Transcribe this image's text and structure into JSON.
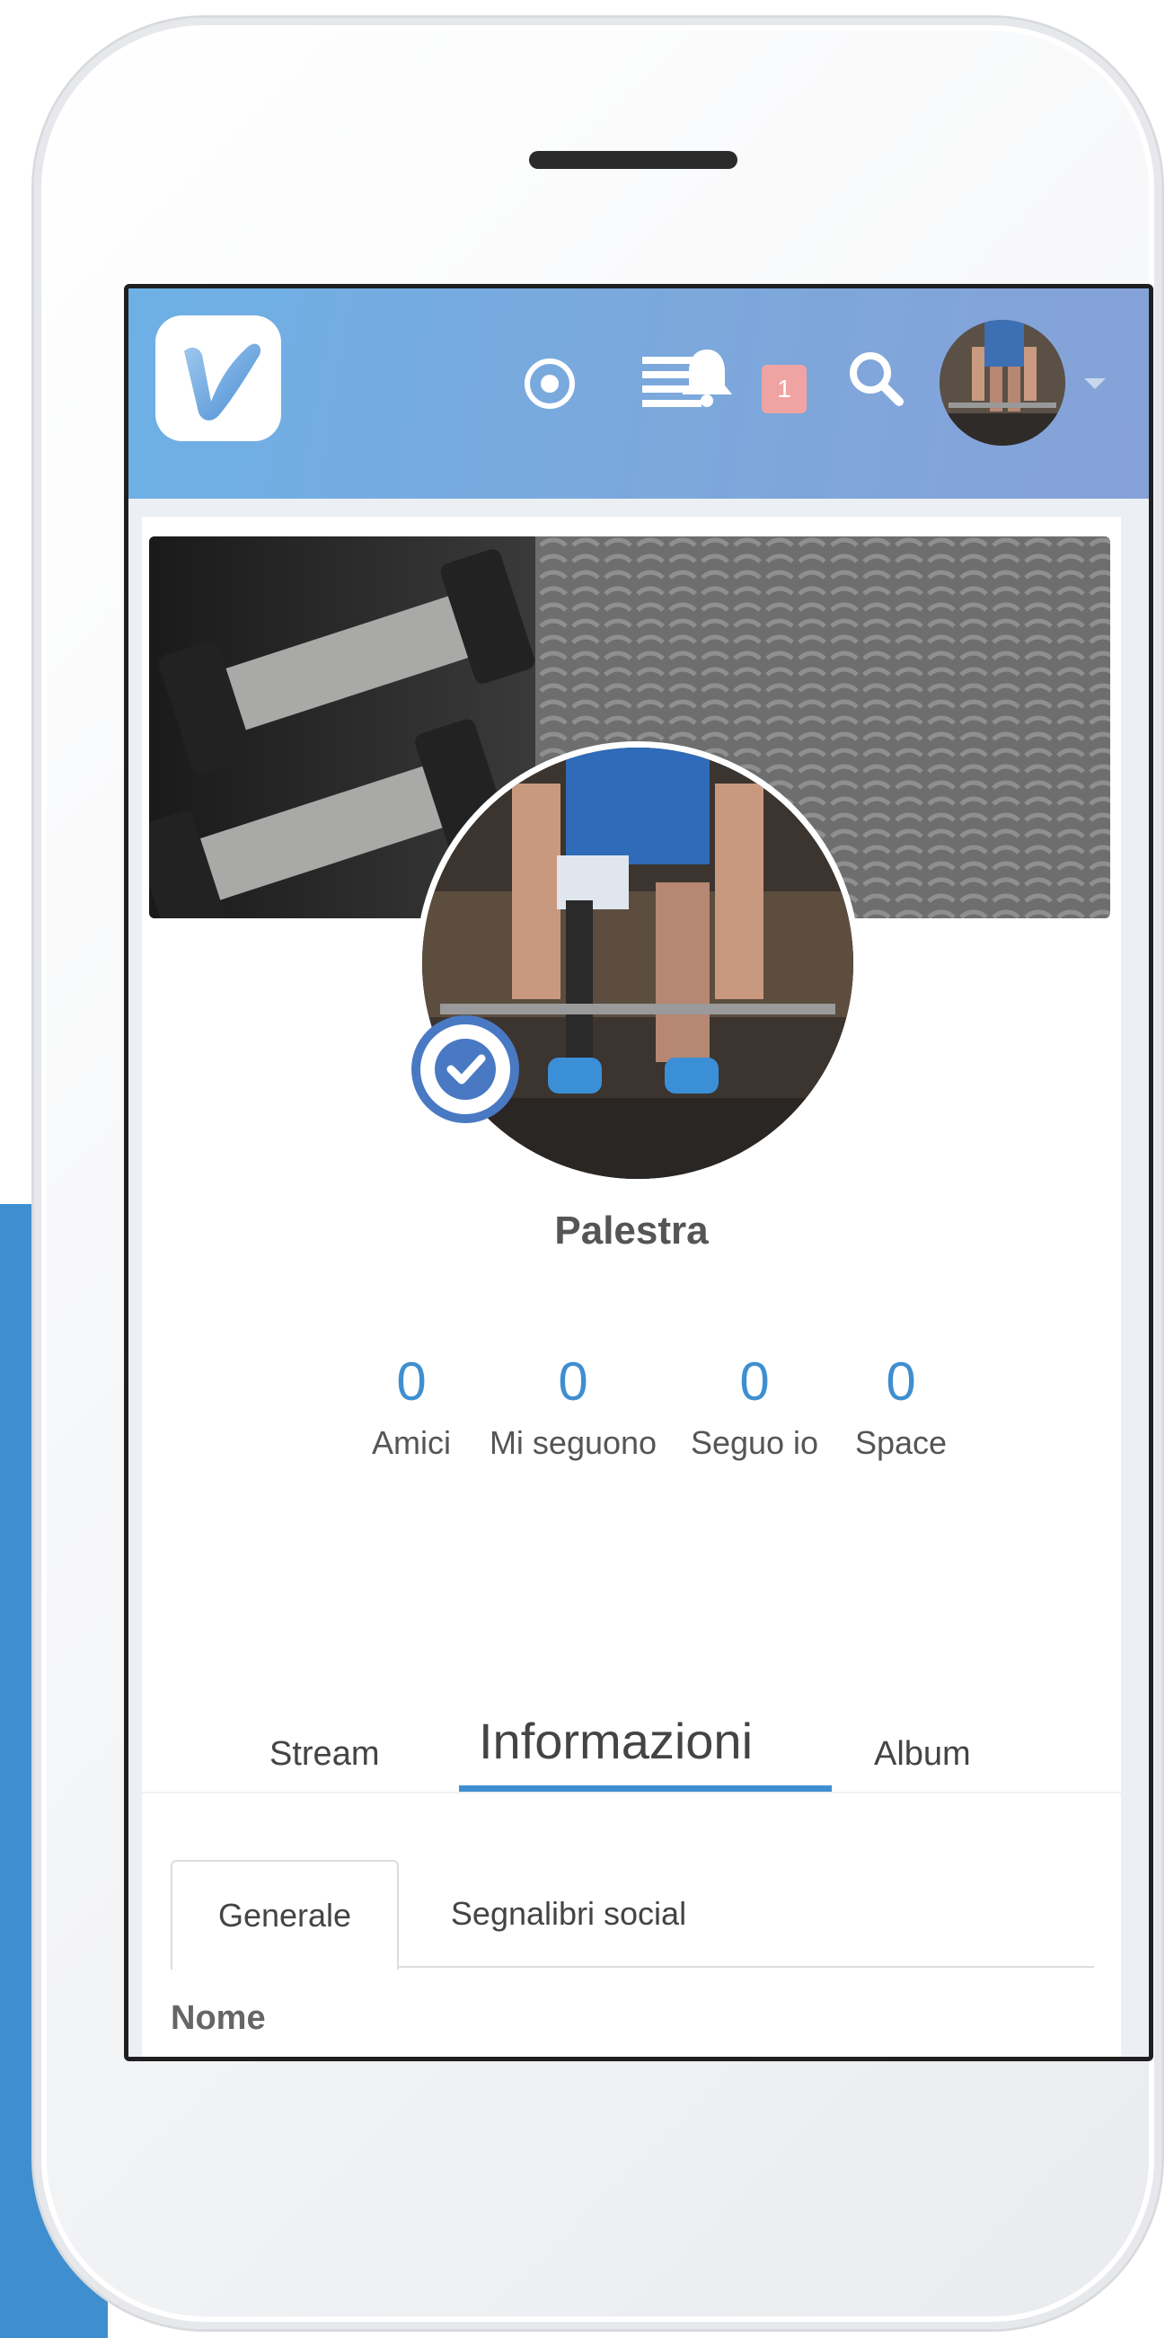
{
  "app": {
    "notifications_count": "1",
    "icons": [
      "logo",
      "target-icon",
      "menu-icon",
      "bell-icon",
      "search-icon",
      "avatar",
      "chevron-down-icon"
    ]
  },
  "profile": {
    "name": "Palestra",
    "stats": [
      {
        "value": "0",
        "label": "Amici"
      },
      {
        "value": "0",
        "label": "Mi seguono"
      },
      {
        "value": "0",
        "label": "Seguo io"
      },
      {
        "value": "0",
        "label": "Space"
      }
    ]
  },
  "tabs": [
    {
      "label": "Stream",
      "active": false
    },
    {
      "label": "Informazioni",
      "active": true
    },
    {
      "label": "Album",
      "active": false
    }
  ],
  "subtabs": [
    {
      "label": "Generale",
      "active": true
    },
    {
      "label": "Segnalibri social",
      "active": false
    }
  ],
  "fields": {
    "nome_label": "Nome"
  },
  "colors": {
    "accent": "#3f8fd0",
    "header_gradient_start": "#6db0e6",
    "header_gradient_end": "#86a2d8",
    "badge": "#f0a3a3",
    "verified": "#4a79c4"
  }
}
